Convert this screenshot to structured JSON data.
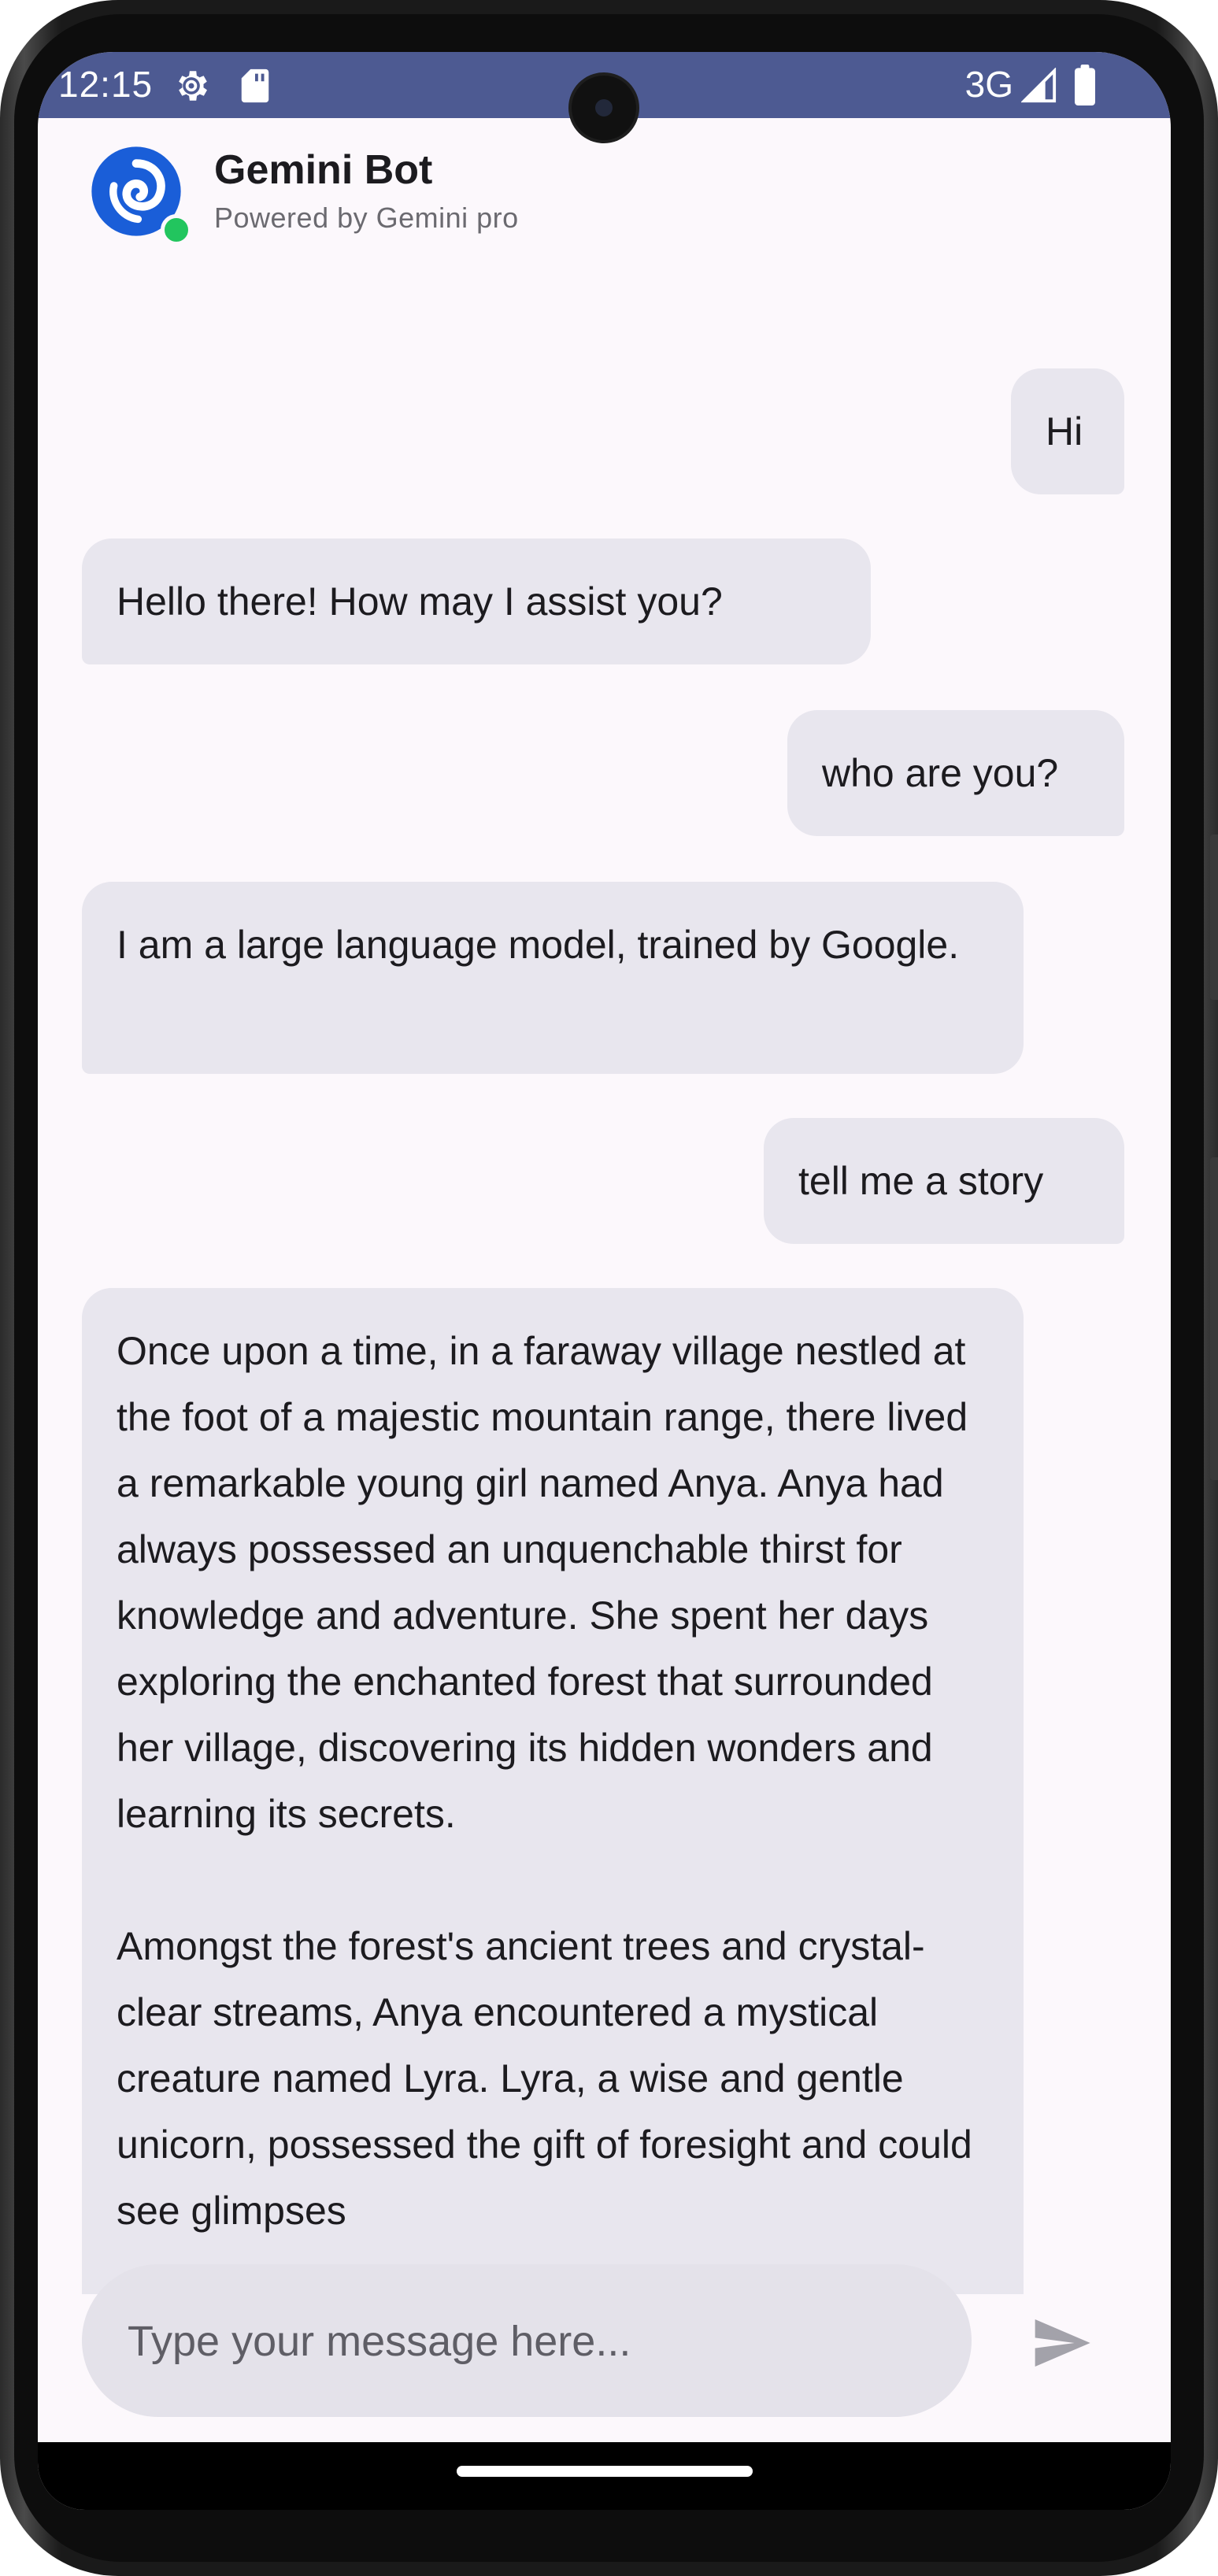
{
  "status_bar": {
    "time": "12:15",
    "network": "3G",
    "colors": {
      "background": "#4d5a92"
    }
  },
  "header": {
    "title": "Gemini Bot",
    "subtitle": "Powered by Gemini pro",
    "online_status_color": "#22c55e",
    "avatar_icon": "gemini-swirl-logo"
  },
  "messages": [
    {
      "sender": "user",
      "text": "Hi"
    },
    {
      "sender": "bot",
      "text": "Hello there! How may I assist you?"
    },
    {
      "sender": "user",
      "text": "who are you?"
    },
    {
      "sender": "bot",
      "text": "I am a large language model, trained by Google."
    },
    {
      "sender": "user",
      "text": "tell me a story"
    },
    {
      "sender": "bot",
      "text": "Once upon a time, in a faraway village nestled at the foot of a majestic mountain range, there lived a remarkable young girl named Anya. Anya had always possessed an unquenchable thirst for knowledge and adventure. She spent her days exploring the enchanted forest that surrounded her village, discovering its hidden wonders and learning its secrets.\n\nAmongst the forest's ancient trees and crystal-clear streams, Anya encountered a mystical creature named Lyra. Lyra, a wise and gentle unicorn, possessed the gift of foresight and could see glimpses"
    }
  ],
  "composer": {
    "placeholder": "Type your message here...",
    "value": "",
    "send_icon": "send-icon"
  },
  "theme": {
    "bubble_color": "#e8e6ee",
    "screen_background": "#fcf8fc",
    "brand_blue": "#1a5ed8"
  }
}
